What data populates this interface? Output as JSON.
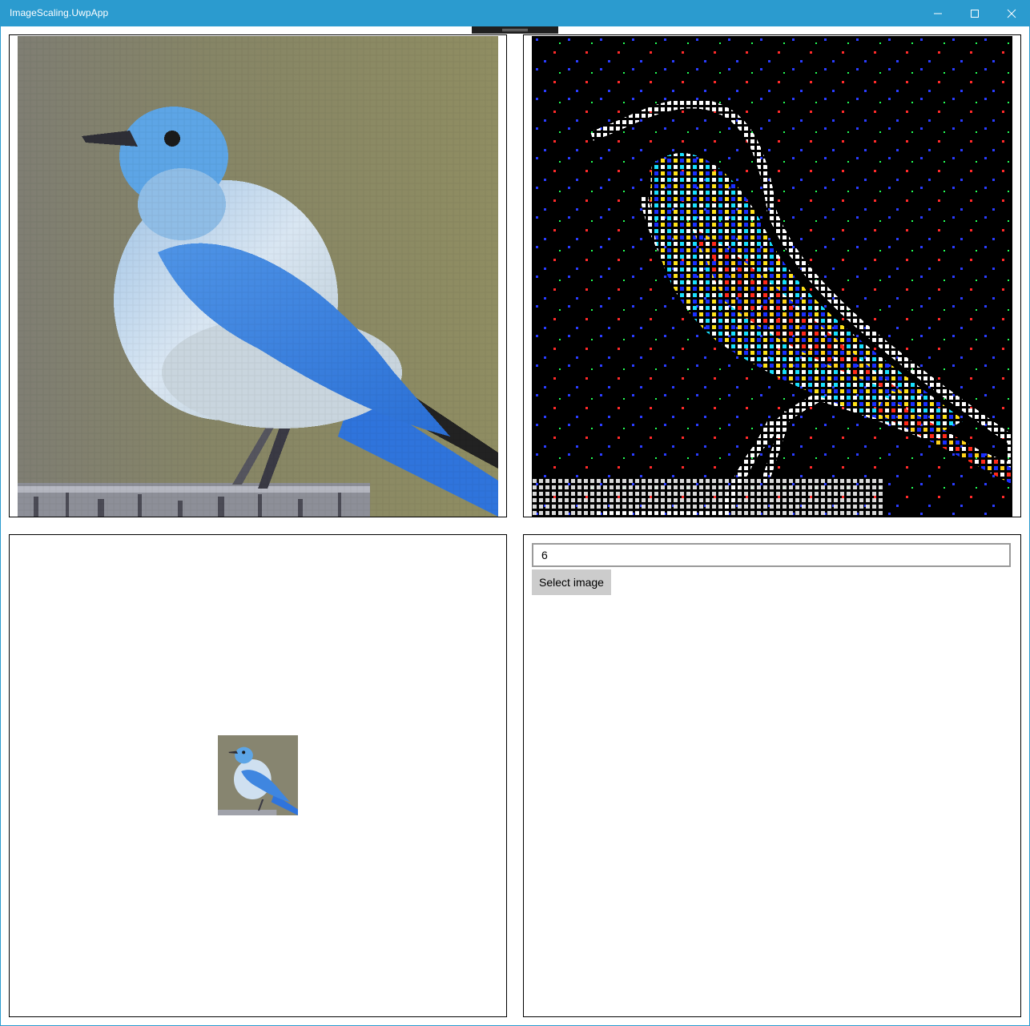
{
  "window": {
    "title": "ImageScaling.UwpApp",
    "accent_color": "#2b9bcf",
    "caption_buttons": [
      {
        "name": "minimize",
        "icon": "minimize-icon"
      },
      {
        "name": "maximize",
        "icon": "maximize-icon"
      },
      {
        "name": "close",
        "icon": "close-icon"
      }
    ]
  },
  "panels": {
    "original": {
      "image_subject": "mountain bluebird perched on a weathered post",
      "image_style": "pixelated upscale"
    },
    "edges": {
      "image_subject": "edge-detected bluebird",
      "image_style": "colored edge pixels on black"
    },
    "thumbnail": {
      "image_subject": "small bluebird thumbnail"
    }
  },
  "controls": {
    "scale_value": "6",
    "select_button_label": "Select image"
  },
  "colors": {
    "bird_blue": "#3f86e0",
    "bird_belly": "#e2ecf6",
    "background_olive": "#8b8b6a",
    "edge_background": "#000000",
    "button_gray": "#cccccc"
  }
}
